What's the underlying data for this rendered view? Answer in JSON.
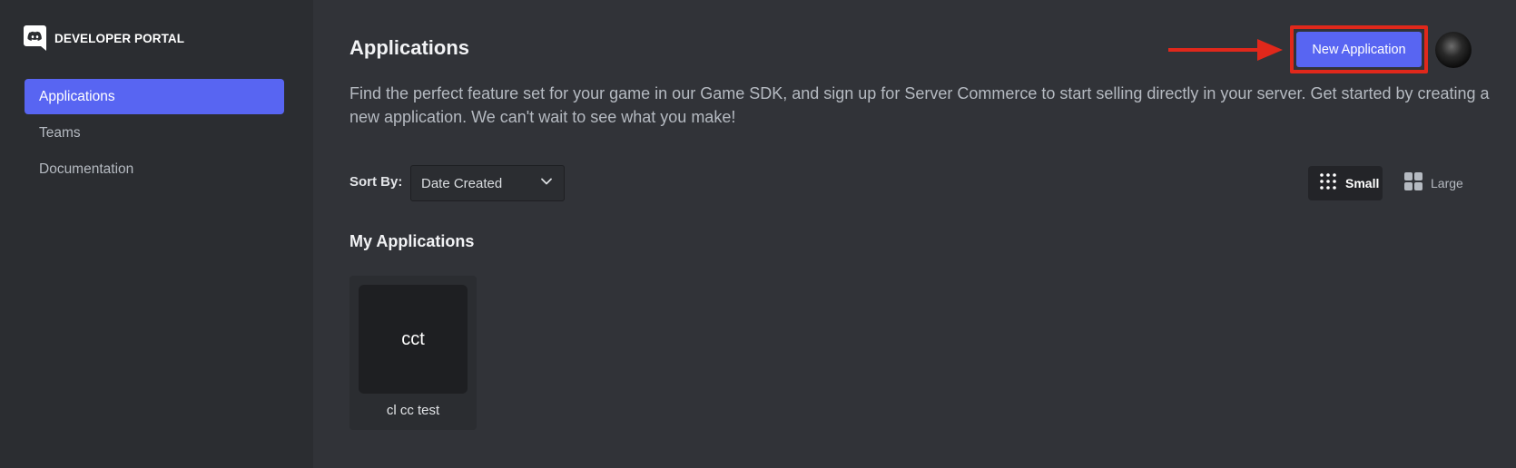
{
  "brand": {
    "title": "DEVELOPER PORTAL",
    "icon": "discord-logo-icon"
  },
  "sidebar": {
    "items": [
      {
        "label": "Applications",
        "active": true
      },
      {
        "label": "Teams",
        "active": false
      },
      {
        "label": "Documentation",
        "active": false
      }
    ]
  },
  "header": {
    "title": "Applications",
    "new_app_label": "New Application",
    "description": "Find the perfect feature set for your game in our Game SDK, and sign up for Server Commerce to start selling directly in your server. Get started by creating a new application. We can't wait to see what you make!"
  },
  "sort": {
    "label": "Sort By:",
    "selected": "Date Created"
  },
  "view": {
    "small_label": "Small",
    "large_label": "Large",
    "selected": "Small"
  },
  "applications": {
    "section_title": "My Applications",
    "items": [
      {
        "icon_text": "cct",
        "name": "cl cc test"
      }
    ]
  },
  "colors": {
    "accent": "#5865f2",
    "highlight": "#e0281b",
    "background": "#313338",
    "sidebar": "#2b2d31"
  }
}
